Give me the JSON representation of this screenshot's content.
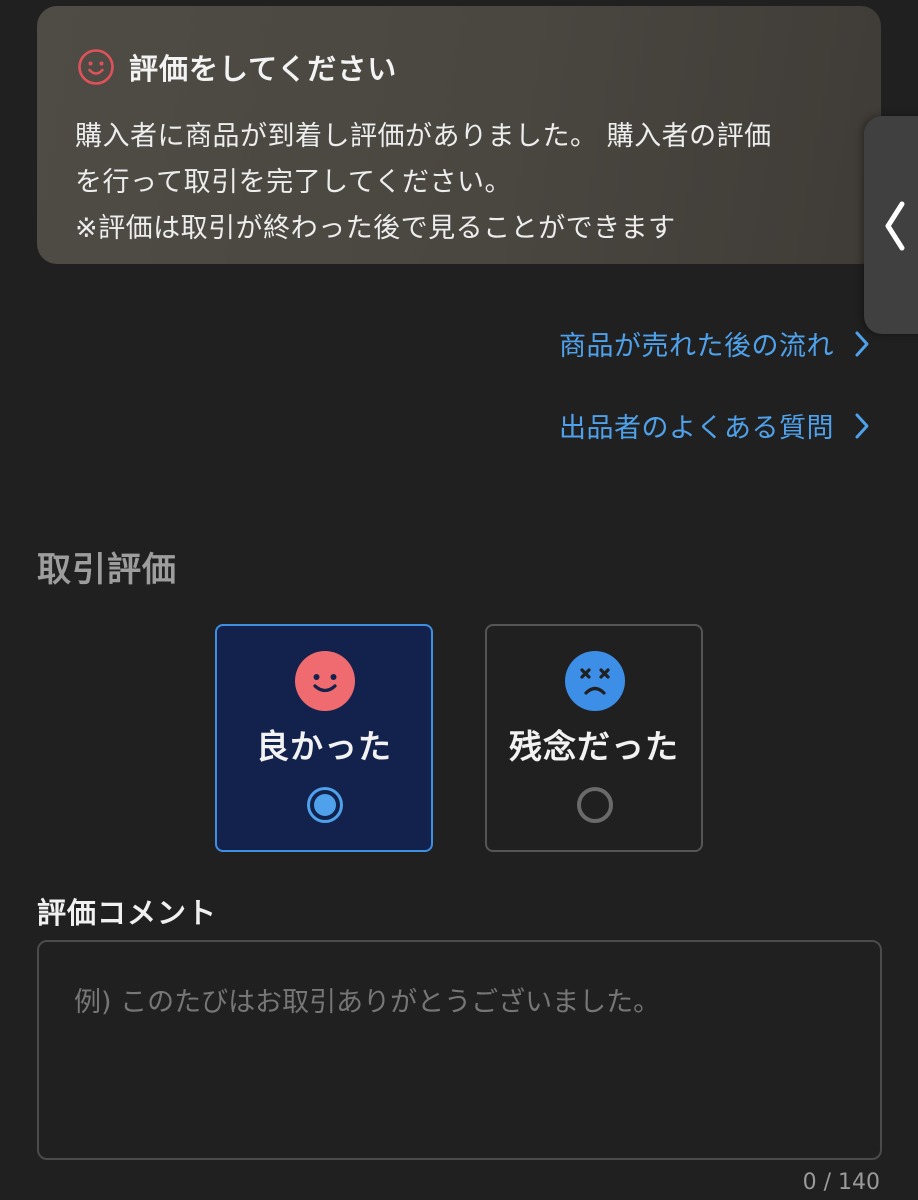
{
  "notice": {
    "title": "評価をしてください",
    "line1": "購入者に商品が到着し評価がありました。 購入者の評価",
    "line2": "を行って取引を完了してください。",
    "line3": "※評価は取引が終わった後で見ることができます",
    "icon": "smile-outline-icon"
  },
  "links": [
    {
      "label": "商品が売れた後の流れ",
      "icon": "chevron-right-icon"
    },
    {
      "label": "出品者のよくある質問",
      "icon": "chevron-right-icon"
    }
  ],
  "rating": {
    "section_title": "取引評価",
    "options": [
      {
        "label": "良かった",
        "icon": "happy-face-icon",
        "selected": true
      },
      {
        "label": "残念だった",
        "icon": "sad-face-icon",
        "selected": false
      }
    ]
  },
  "comment": {
    "label": "評価コメント",
    "placeholder": "例) このたびはお取引ありがとうございました。",
    "value": "",
    "count": "0 / 140"
  },
  "colors": {
    "background": "#202020",
    "notice_bg": "#4c4842",
    "link": "#4ea1ea",
    "selected_border": "#3f8fe0",
    "selected_bg": "#12224c",
    "happy_face": "#ef6b70",
    "sad_face": "#3c8ee6"
  }
}
